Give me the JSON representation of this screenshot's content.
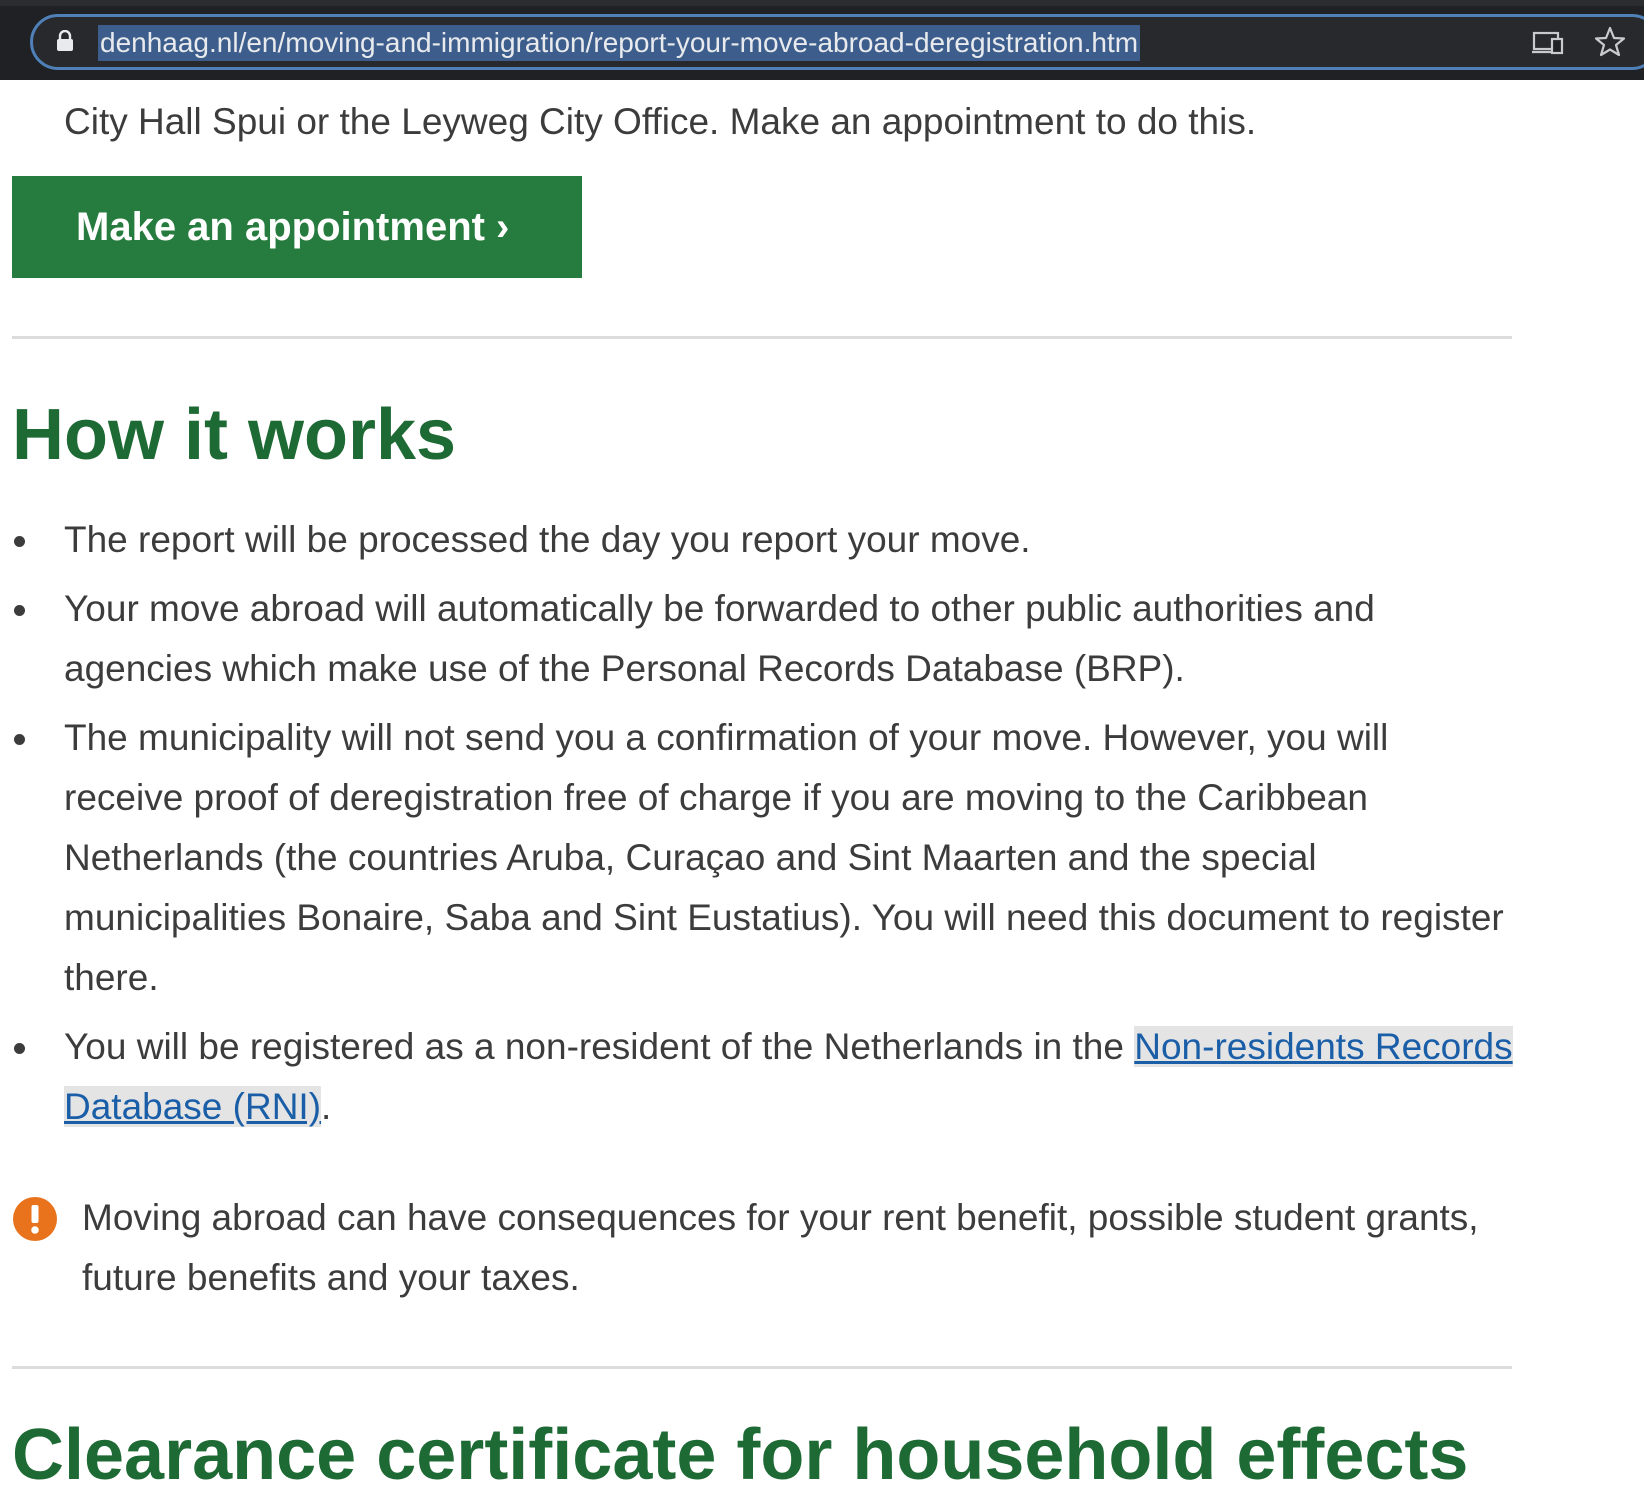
{
  "browser": {
    "url": "denhaag.nl/en/moving-and-immigration/report-your-move-abroad-deregistration.htm",
    "icons": [
      "lock-icon",
      "cast-icon",
      "star-icon"
    ]
  },
  "page": {
    "intro_text": "City Hall Spui or the Leyweg City Office. Make an appointment to do this.",
    "appointment_button": "Make an appointment ›",
    "how_it_works": {
      "heading": "How it works",
      "items": [
        "The report will be processed the day you report your move.",
        "Your move abroad will automatically be forwarded to other public authorities and agencies which make use of the Personal Records Database (BRP).",
        "The municipality will not send you a confirmation of your move. However, you will receive proof of deregistration free of charge if you are moving to the Caribbean Netherlands (the countries Aruba, Curaçao and Sint Maarten and the special municipalities Bonaire, Saba and Sint Eustatius). You will need this document to register there."
      ],
      "rni_item": {
        "before": "You will be registered as a non-resident of the Netherlands in the ",
        "link": "Non-residents Records Database (RNI)",
        "after": "."
      }
    },
    "notice": {
      "icon": "exclamation-icon",
      "text": "Moving abroad can have consequences for your rent benefit, possible student grants, future benefits and your taxes."
    },
    "next_heading": "Clearance certificate for household effects"
  },
  "colors": {
    "brand_green": "#267c3e",
    "heading_green": "#1e6a34",
    "link_blue": "#1a5ea8",
    "warning_orange": "#e8731c"
  }
}
